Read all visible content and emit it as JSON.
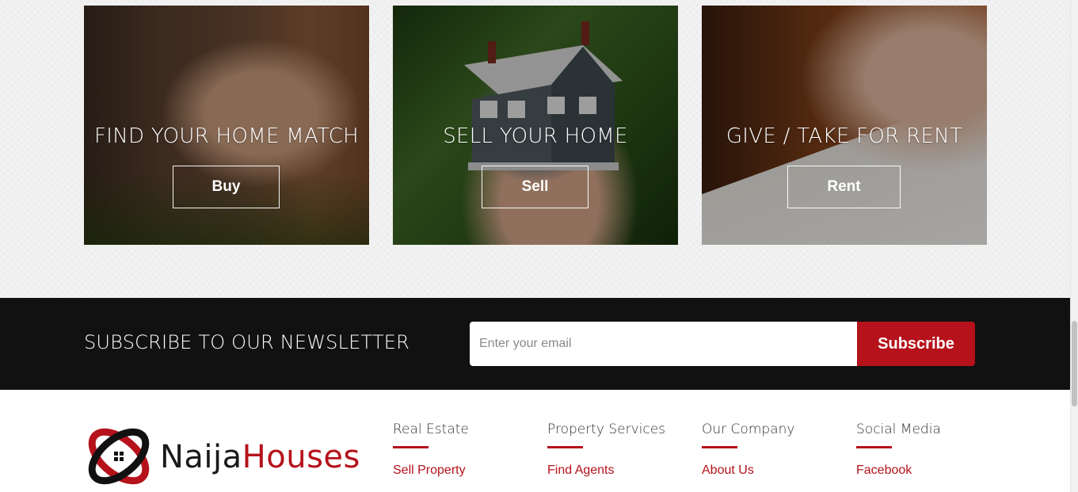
{
  "cards": [
    {
      "title": "FIND YOUR HOME MATCH",
      "button": "Buy"
    },
    {
      "title": "SELL YOUR HOME",
      "button": "Sell"
    },
    {
      "title": "GIVE / TAKE FOR RENT",
      "button": "Rent"
    }
  ],
  "newsletter": {
    "title": "SUBSCRIBE TO OUR NEWSLETTER",
    "email_placeholder": "Enter your email",
    "subscribe_label": "Subscribe"
  },
  "footer": {
    "logo": {
      "part1": "Naija",
      "part2": "Houses"
    },
    "columns": [
      {
        "heading": "Real Estate",
        "links": [
          "Sell Property"
        ]
      },
      {
        "heading": "Property Services",
        "links": [
          "Find Agents"
        ]
      },
      {
        "heading": "Our Company",
        "links": [
          "About Us"
        ]
      },
      {
        "heading": "Social Media",
        "links": [
          "Facebook"
        ]
      }
    ]
  },
  "colors": {
    "brand_red": "#b5121b",
    "newsletter_bg": "#111111"
  }
}
